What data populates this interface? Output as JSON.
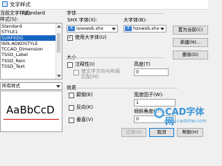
{
  "window": {
    "title": "文字样式"
  },
  "styles_panel": {
    "current_label": "当前文字样式：",
    "current_value": "Standard",
    "styles_label": "样式(S):",
    "items": [
      "Standard",
      "STYLE1",
      "SURFKDG",
      "tblk-AOKOSTYLE",
      "TCCAD_Dimension",
      "TSSD_Label",
      "TSSD_Rein",
      "TSSD_Text"
    ],
    "filter_label": "所有样式"
  },
  "font_group": {
    "label": "字体",
    "shx_label": "SHX 字体(X):",
    "shx_value": "isoxwsb.shx",
    "big_label": "大字体(B):",
    "big_value": "hzxwsb.shx",
    "big_font_checkbox": "使用大字体(U)",
    "big_font_checked": true,
    "glyph_shx": "A",
    "glyph_big": "A"
  },
  "size_group": {
    "label": "大小",
    "annotative_checkbox": "注释性(I)",
    "match_orientation_line1": "使文字方向与布局",
    "match_orientation_line2": "匹配(M)",
    "height_label": "高度(T)",
    "height_value": "0"
  },
  "effects_group": {
    "label": "效果",
    "upside_down": "颠倒(E)",
    "backwards": "反向(K)",
    "vertical": "垂直(V)",
    "width_factor_label": "宽度因子(W):",
    "width_factor_value": "1",
    "oblique_label": "倾斜角度(O):",
    "oblique_value": "0"
  },
  "buttons": {
    "set_current": "置为当前(C)",
    "new": "新建(N)...",
    "delete": "删除(D)",
    "apply": "应用(A)",
    "cancel": "取消",
    "help": "帮助(H)"
  },
  "preview": {
    "sample": "AaBbCcD"
  },
  "watermark": {
    "brand": "CAD字体网",
    "url": "www.cadzitw.com"
  },
  "colors": {
    "selection": "#1565c0",
    "watermark": "#3a93d6"
  }
}
